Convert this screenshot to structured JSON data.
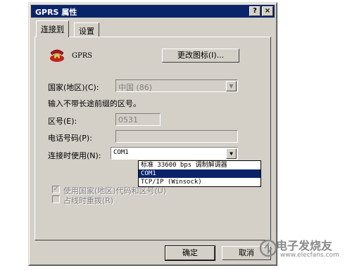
{
  "window": {
    "title": "GPRS 属性",
    "help_button": "?",
    "close_button": "×"
  },
  "tabs": [
    {
      "label": "连接到"
    },
    {
      "label": "设置"
    }
  ],
  "connection": {
    "icon": "phone-icon",
    "name": "GPRS",
    "change_icon_button": "更改图标(I)..."
  },
  "country": {
    "label": "国家(地区)(C):",
    "value": "中国 (86)"
  },
  "area_note": "输入不带长途前缀的区号。",
  "area_code": {
    "label": "区号(E):",
    "value": "0531"
  },
  "phone": {
    "label": "电话号码(P):",
    "value": ""
  },
  "connect_using": {
    "label": "连接时使用(N):",
    "value": "COM1",
    "options": [
      "标准 33600 bps 调制解调器",
      "COM1",
      "TCP/IP (Winsock)"
    ],
    "selected_index": 1
  },
  "checkboxes": [
    {
      "label": "使用国家(地区)代码和区号(U)",
      "checked": true,
      "disabled": true
    },
    {
      "label": "占线时重拨(R)",
      "checked": false,
      "disabled": true
    }
  ],
  "buttons": {
    "ok": "确定",
    "cancel": "取消"
  },
  "watermark": {
    "text": "电子发烧友",
    "url": "www.elecfans.com"
  }
}
